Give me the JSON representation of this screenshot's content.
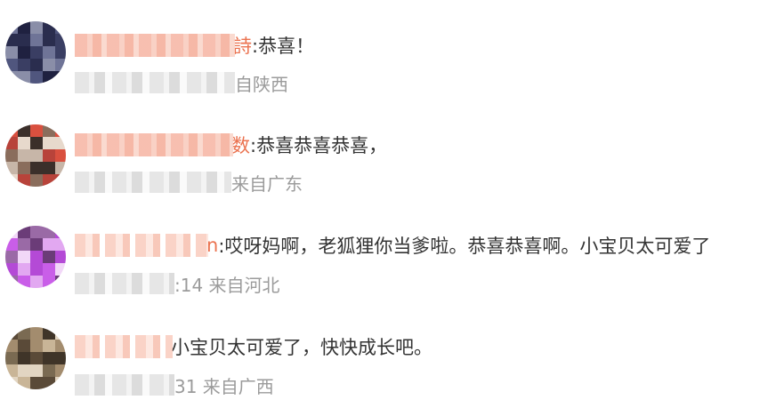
{
  "comments": [
    {
      "name_tail": "詩",
      "text": ":恭喜！",
      "meta": "自陕西"
    },
    {
      "name_tail": "数",
      "text": ":恭喜恭喜恭喜，",
      "meta": "来自广东"
    },
    {
      "name_tail": "n",
      "text": ":哎呀妈啊，老狐狸你当爹啦。恭喜恭喜啊。小宝贝太可爱了",
      "meta": ":14 来自河北"
    },
    {
      "name_tail": "",
      "text": "小宝贝太可爱了，快快成长吧。",
      "meta": "31 来自广西"
    }
  ],
  "avatar_palettes": [
    [
      "#2a2d4e",
      "#3a3e63",
      "#50567e",
      "#6f7497",
      "#1f2140",
      "#8a8ea8"
    ],
    [
      "#b8433a",
      "#d9503f",
      "#8a6d5c",
      "#3b2f2a",
      "#c7b6a8",
      "#e7d9cc"
    ],
    [
      "#b44ad6",
      "#c95ee8",
      "#6b3c78",
      "#e2a8f1",
      "#9a6aa6",
      "#f2d8f8"
    ],
    [
      "#7a6a52",
      "#a38c6e",
      "#c9b597",
      "#5a4a38",
      "#e2d5c2",
      "#3f3428"
    ]
  ]
}
